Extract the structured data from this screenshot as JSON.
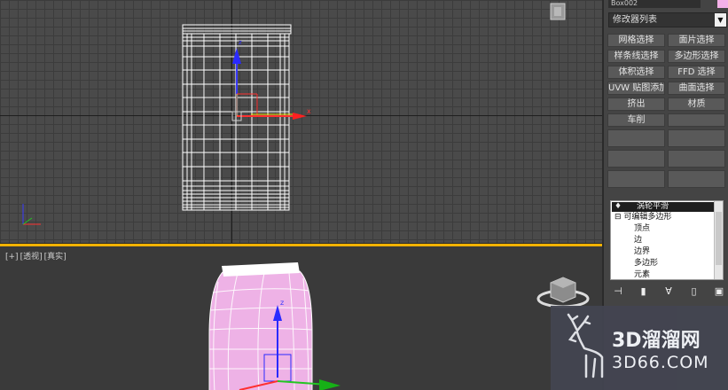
{
  "top_viewport": {
    "axis_x_label": "x",
    "axis_z_label": "z"
  },
  "bottom_viewport": {
    "label_plus": "[+]",
    "label_view": "[透视]",
    "label_shading": "[真实]",
    "axis_z_label": "z"
  },
  "command_panel": {
    "object_name": "Box002",
    "object_color": "#f4b0e8",
    "modifier_list": "修改器列表",
    "buttons": [
      [
        "网格选择",
        "面片选择"
      ],
      [
        "样条线选择",
        "多边形选择"
      ],
      [
        "体积选择",
        "FFD 选择"
      ],
      [
        "UVW 贴图添加",
        "曲面选择"
      ],
      [
        "挤出",
        "材质"
      ],
      [
        "车削",
        ""
      ],
      [
        "",
        ""
      ],
      [
        "",
        ""
      ],
      [
        "",
        ""
      ]
    ],
    "stack": {
      "turbosmooth": "涡轮平滑",
      "edit_poly": "可编辑多边形",
      "sub_vertex": "顶点",
      "sub_edge": "边",
      "sub_border": "边界",
      "sub_polygon": "多边形",
      "sub_element": "元素"
    },
    "stack_tools": [
      "pin-stack-icon",
      "show-end-result-icon",
      "make-unique-icon",
      "remove-modifier-icon",
      "configure-sets-icon"
    ]
  },
  "watermark": {
    "brand": "3D溜溜网",
    "url": "3D66.COM"
  },
  "colors": {
    "selection_outline": "#f2b200",
    "mesh_fill": "#eeb2e6",
    "wire": "#ffffff",
    "axis_x": "#ff3030",
    "axis_y": "#23c623",
    "axis_z": "#3a3aff"
  }
}
